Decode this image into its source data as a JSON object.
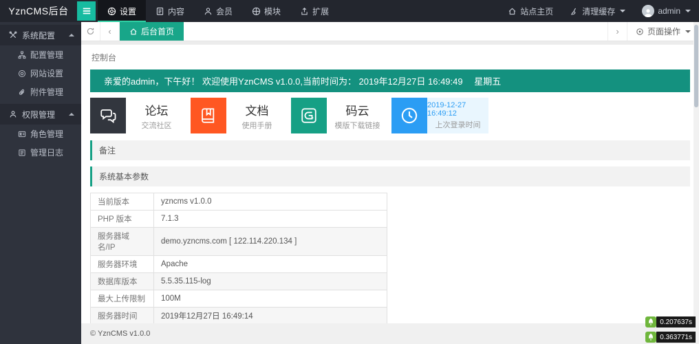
{
  "topbar": {
    "logo": "YznCMS后台",
    "nav": [
      {
        "label": "设置",
        "icon": "gear-icon",
        "active": true
      },
      {
        "label": "内容",
        "icon": "document-icon",
        "active": false
      },
      {
        "label": "会员",
        "icon": "user-icon",
        "active": false
      },
      {
        "label": "模块",
        "icon": "module-icon",
        "active": false
      },
      {
        "label": "扩展",
        "icon": "expand-icon",
        "active": false
      }
    ],
    "right": {
      "site_home": {
        "label": "站点主页",
        "icon": "home-icon"
      },
      "clear_cache": {
        "label": "清理缓存",
        "icon": "broom-icon"
      },
      "user": {
        "label": "admin",
        "icon": "avatar"
      }
    }
  },
  "sidebar": {
    "groups": [
      {
        "label": "系统配置",
        "icon": "wrench-icon",
        "expanded": true,
        "items": [
          {
            "label": "配置管理",
            "icon": "sitemap-icon"
          },
          {
            "label": "网站设置",
            "icon": "gear-icon"
          },
          {
            "label": "附件管理",
            "icon": "paperclip-icon"
          }
        ]
      },
      {
        "label": "权限管理",
        "icon": "user-icon",
        "expanded": true,
        "items": [
          {
            "label": "角色管理",
            "icon": "idcard-icon"
          },
          {
            "label": "管理日志",
            "icon": "log-icon"
          }
        ]
      }
    ]
  },
  "tabbar": {
    "tabs": [
      {
        "label": "后台首页",
        "icon": "home-icon",
        "active": true
      }
    ],
    "page_actions_label": "页面操作"
  },
  "main": {
    "breadcrumb": "控制台",
    "welcome": "亲爱的admin，下午好！ 欢迎使用YznCMS v1.0.0,当前时间为： 2019年12月27日 16:49:49　 星期五",
    "cards": [
      {
        "title": "论坛",
        "subtitle": "交流社区",
        "icon": "comments-icon",
        "color": "#32363e"
      },
      {
        "title": "文档",
        "subtitle": "使用手册",
        "icon": "book-icon",
        "color": "#ff5722"
      },
      {
        "title": "码云",
        "subtitle": "模版下载链接",
        "icon": "gitee-icon",
        "color": "#16a085"
      },
      {
        "title": "2019-12-27 16:49:12",
        "subtitle": "上次登录时间",
        "icon": "clock-icon",
        "color": "#2b9df4",
        "highlight": true
      }
    ],
    "sections": {
      "notes": "备注",
      "system_params": "系统基本参数"
    },
    "table": {
      "rows": [
        {
          "key": "当前版本",
          "value": "yzncms v1.0.0"
        },
        {
          "key": "PHP 版本",
          "value": "7.1.3"
        },
        {
          "key": "服务器域名/IP",
          "value": "demo.yzncms.com [ 122.114.220.134 ]"
        },
        {
          "key": "服务器环境",
          "value": "Apache"
        },
        {
          "key": "数据库版本",
          "value": "5.5.35.115-log"
        },
        {
          "key": "最大上传限制",
          "value": "100M"
        },
        {
          "key": "服务器时间",
          "value": "2019年12月27日 16:49:14"
        }
      ]
    }
  },
  "footer": {
    "copyright": "© YznCMS v1.0.0"
  },
  "trace_badges": [
    {
      "time": "0.207637s",
      "icon": "leaf-icon",
      "color": "#6fb63c"
    },
    {
      "time": "0.363771s",
      "icon": "leaf-icon",
      "color": "#6fb63c"
    }
  ],
  "colors": {
    "topbar_bg": "#23262e",
    "sidebar_bg": "#2f333d",
    "accent_teal": "#17bba0",
    "tab_green": "#18a689",
    "banner_teal": "#14917f",
    "card_orange": "#ff5722",
    "card_green": "#16a085",
    "card_blue": "#2b9df4",
    "badge_green": "#6fb63c"
  }
}
